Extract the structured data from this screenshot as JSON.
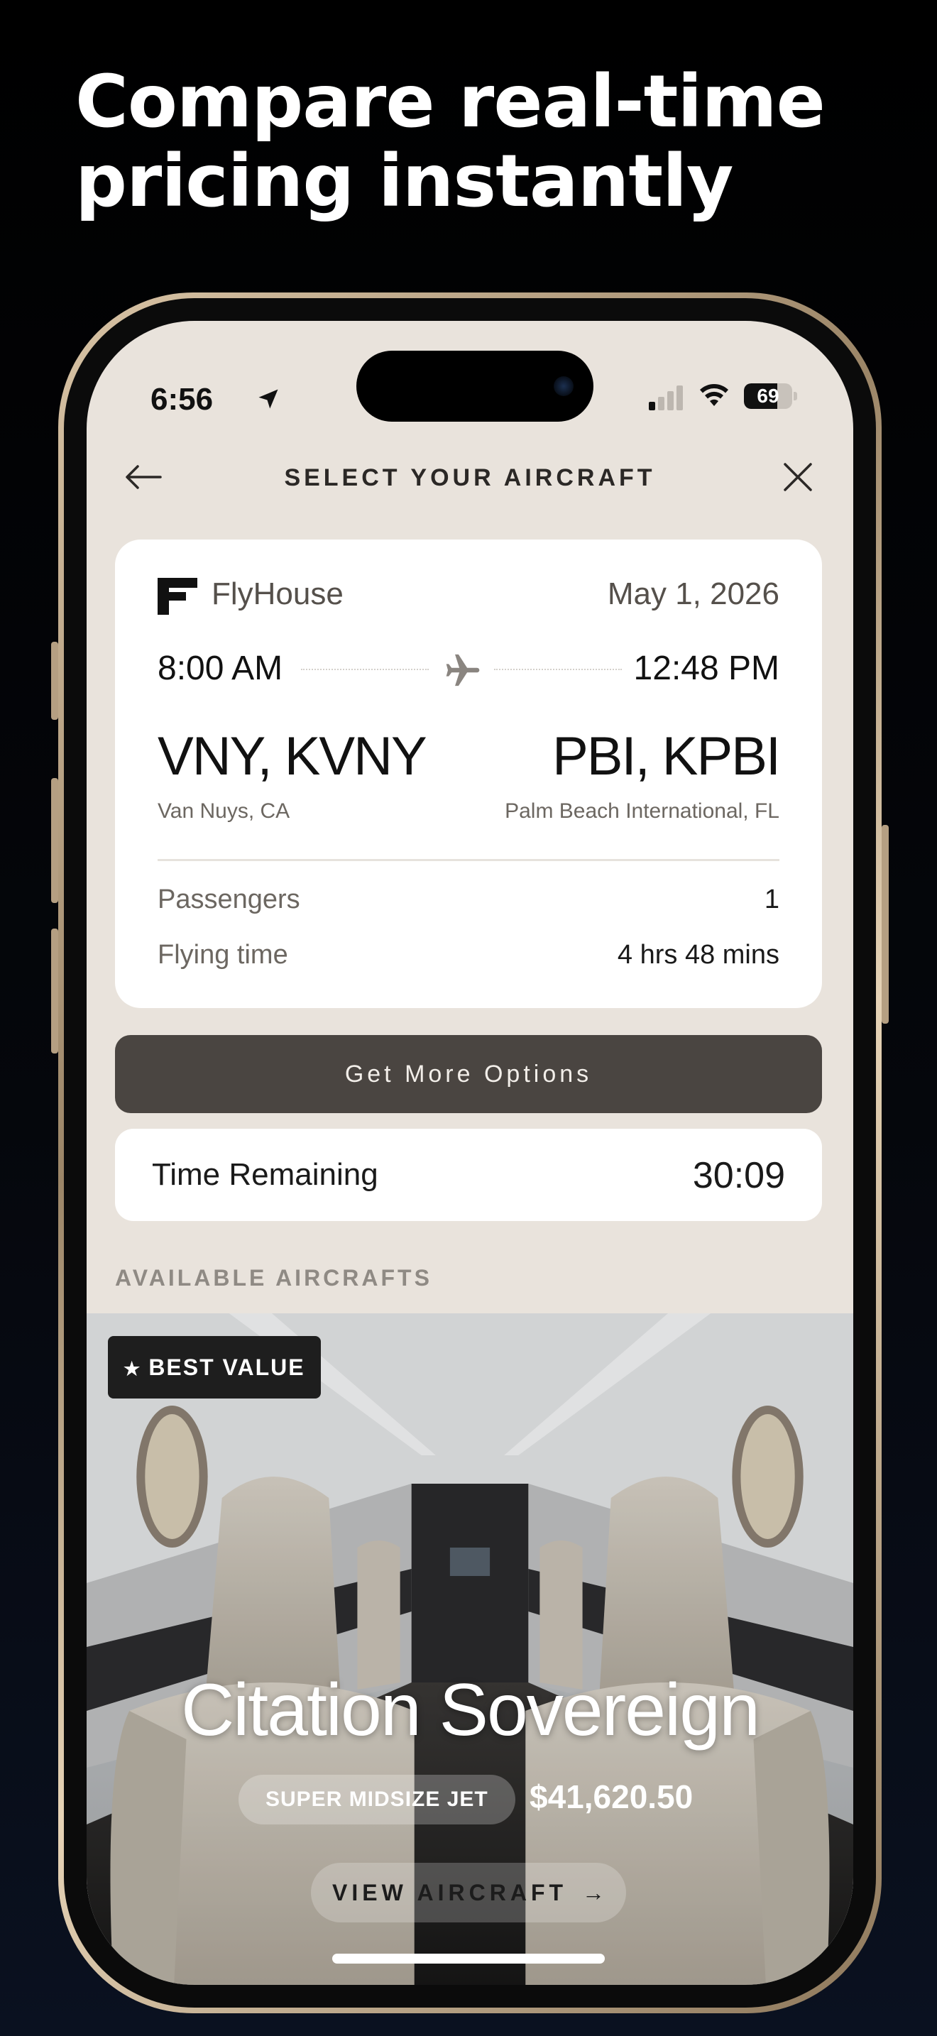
{
  "headline": {
    "line1": "Compare real-time",
    "line2": "pricing instantly"
  },
  "status_bar": {
    "time": "6:56",
    "battery": "69",
    "battery_level": 0.69
  },
  "header": {
    "title": "SELECT YOUR AIRCRAFT"
  },
  "trip": {
    "brand": "FlyHouse",
    "date": "May 1, 2026",
    "departure_time": "8:00 AM",
    "arrival_time": "12:48 PM",
    "departure_code": "VNY, KVNY",
    "arrival_code": "PBI, KPBI",
    "departure_city": "Van Nuys, CA",
    "arrival_city": "Palm Beach International, FL",
    "passengers_label": "Passengers",
    "passengers_value": "1",
    "flying_time_label": "Flying time",
    "flying_time_value": "4 hrs 48 mins"
  },
  "actions": {
    "more_options": "Get More Options"
  },
  "timer": {
    "label": "Time Remaining",
    "value": "30:09"
  },
  "section": {
    "title": "AVAILABLE AIRCRAFTS"
  },
  "aircraft": {
    "badge": "BEST VALUE",
    "name": "Citation Sovereign",
    "category": "SUPER MIDSIZE JET",
    "price": "$41,620.50",
    "view_label": "VIEW AIRCRAFT"
  },
  "colors": {
    "screen_bg": "#e9e3dc",
    "button_dark": "#4a4541",
    "frame_gold": "#c8b396"
  }
}
